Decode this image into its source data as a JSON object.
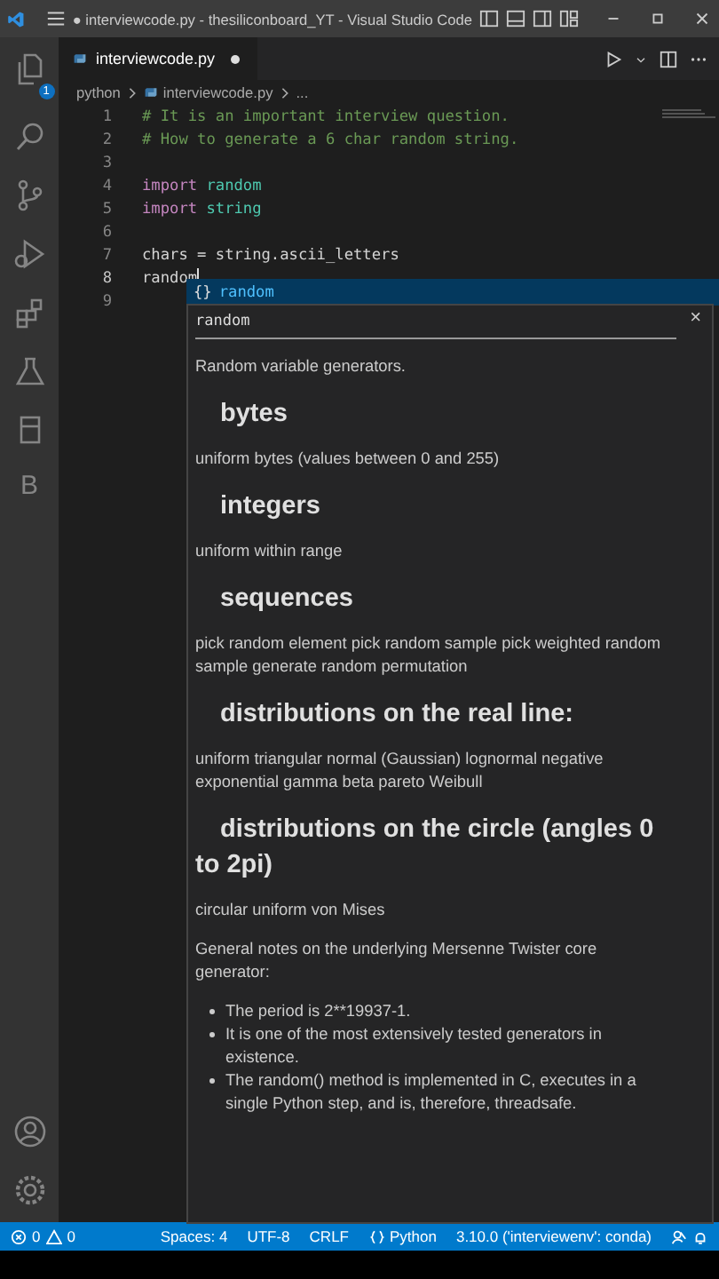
{
  "window": {
    "title": "● interviewcode.py - thesiliconboard_YT - Visual Studio Code"
  },
  "activity_bar": {
    "explorer_badge": "1",
    "bottom_letter": "B"
  },
  "tabs": [
    {
      "label": "interviewcode.py",
      "selected": true,
      "modified": true
    }
  ],
  "breadcrumb": [
    "python",
    "interviewcode.py",
    "..."
  ],
  "code": [
    {
      "number": "1",
      "tokens": [
        {
          "text": "# It is an important interview question.",
          "kind": "comment"
        }
      ]
    },
    {
      "number": "2",
      "tokens": [
        {
          "text": "# How to generate a 6 char random string.",
          "kind": "comment"
        }
      ]
    },
    {
      "number": "3"
    },
    {
      "number": "4",
      "tokens": [
        {
          "text": "import",
          "kind": "keyword"
        },
        {
          "text": " random",
          "kind": "module"
        }
      ]
    },
    {
      "number": "5",
      "tokens": [
        {
          "text": "import",
          "kind": "keyword"
        },
        {
          "text": " string",
          "kind": "module"
        }
      ]
    },
    {
      "number": "6"
    },
    {
      "number": "7",
      "tokens": [
        {
          "text": "chars = string.ascii_letters",
          "kind": "plain"
        }
      ]
    },
    {
      "number": "8",
      "current": true,
      "tokens": [
        {
          "text": "random",
          "kind": "plain"
        }
      ]
    },
    {
      "number": "9"
    }
  ],
  "suggestion": {
    "icon": "{}",
    "label": "random",
    "selected": true
  },
  "doc": {
    "title": "random",
    "close": "×",
    "blocks": [
      {
        "kind": "para",
        "text": "Random variable generators."
      },
      {
        "kind": "heading",
        "text": "bytes"
      },
      {
        "kind": "para",
        "text": "uniform bytes (values between 0 and 255)"
      },
      {
        "kind": "heading",
        "text": "integers"
      },
      {
        "kind": "para",
        "text": "uniform within range"
      },
      {
        "kind": "heading",
        "text": "sequences"
      },
      {
        "kind": "para",
        "text": "pick random element pick random sample pick weighted random sample generate random permutation"
      },
      {
        "kind": "heading",
        "text": "distributions on the real line:"
      },
      {
        "kind": "para",
        "text": "uniform triangular normal (Gaussian) lognormal negative exponential gamma beta pareto Weibull"
      },
      {
        "kind": "heading",
        "text": "distributions on the circle (angles 0 to 2pi)"
      },
      {
        "kind": "para",
        "text": "circular uniform von Mises"
      },
      {
        "kind": "para",
        "text": "General notes on the underlying Mersenne Twister core generator:"
      },
      {
        "kind": "bullets",
        "items": [
          "The period is 2**19937-1.",
          "It is one of the most extensively tested generators in existence.",
          "The random() method is implemented in C, executes in a single Python step, and is, therefore, threadsafe."
        ]
      }
    ]
  },
  "status_bar": {
    "errors": "0",
    "warnings": "0",
    "items": [
      "Spaces: 4",
      "UTF-8",
      "CRLF"
    ],
    "language": "Python",
    "interpreter": "3.10.0 ('interviewenv': conda)"
  }
}
